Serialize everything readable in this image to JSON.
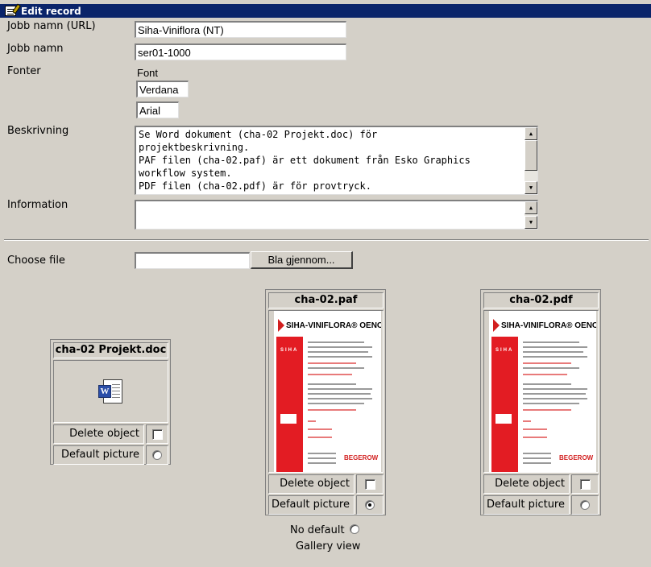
{
  "titlebar": {
    "title": "Edit record"
  },
  "form": {
    "job_url_label": "Jobb namn (URL)",
    "job_url_value": "Siha-Viniflora (NT)",
    "job_name_label": "Jobb namn",
    "job_name_value": "ser01-1000",
    "fonts_label": "Fonter",
    "font_heading": "Font",
    "font1": "Verdana",
    "font2": "Arial",
    "description_label": "Beskrivning",
    "description_lines": [
      "Se Word dokument (cha-02 Projekt.doc) för",
      "projektbeskrivning.",
      "PAF filen (cha-02.paf) är ett dokument från Esko Graphics",
      "workflow system.",
      "PDF filen (cha-02.pdf) är för provtryck."
    ],
    "information_label": "Information",
    "information_value": "",
    "choose_file_label": "Choose file",
    "browse_label": "Bla gjennom..."
  },
  "objects": [
    {
      "title": "cha-02 Projekt.doc",
      "icon": "word-document-icon",
      "delete_label": "Delete object",
      "delete_checked": false,
      "default_label": "Default picture",
      "default_selected": false
    },
    {
      "title": "cha-02.paf",
      "thumb_brand": "SIHA-VINIFLORA® OENOS",
      "thumb_side": "SIHA",
      "thumb_footer": "BEGEROW",
      "delete_label": "Delete object",
      "delete_checked": false,
      "default_label": "Default picture",
      "default_selected": true
    },
    {
      "title": "cha-02.pdf",
      "thumb_brand": "SIHA-VINIFLORA® OENOS",
      "thumb_side": "SIHA",
      "thumb_footer": "BEGEROW",
      "delete_label": "Delete object",
      "delete_checked": false,
      "default_label": "Default picture",
      "default_selected": false
    }
  ],
  "footer": {
    "no_default_label": "No default",
    "no_default_selected": false,
    "gallery_view_label": "Gallery view"
  }
}
